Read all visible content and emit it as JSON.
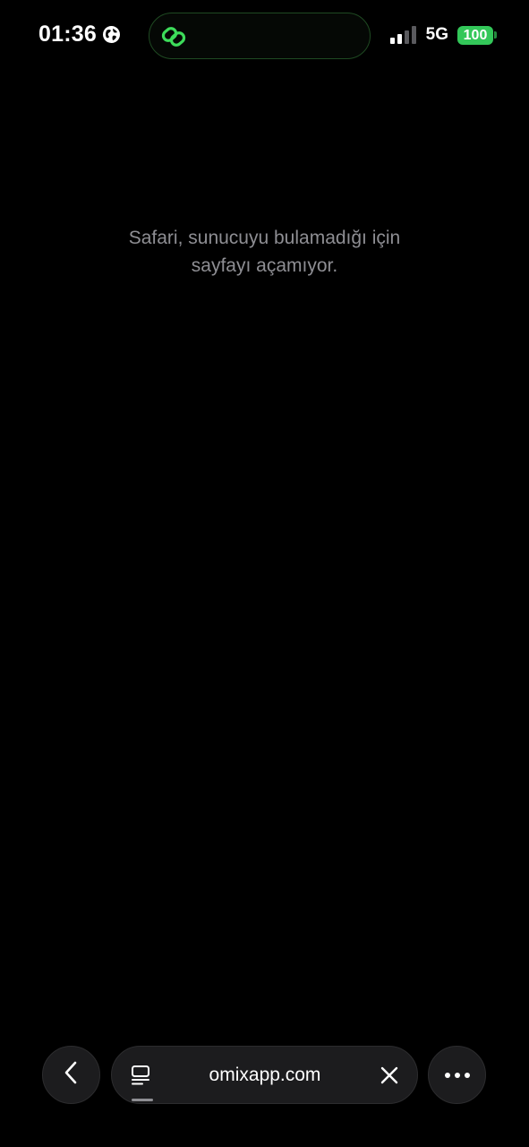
{
  "status_bar": {
    "time": "01:36",
    "time_icon": "globe-icon",
    "island_icon": "link-icon",
    "network": "5G",
    "signal_icon": "cellular-signal-icon",
    "battery_level": "100",
    "battery_color": "#33c759",
    "island_accent": "#3ddc5a"
  },
  "page": {
    "error_line_1": "Safari, sunucuyu bulamadığı için",
    "error_line_2": "sayfayı açamıyor."
  },
  "toolbar": {
    "back_icon": "chevron-left-icon",
    "tabs_icon": "tabs-icon",
    "url": "omixapp.com",
    "clear_icon": "close-icon",
    "more_icon": "ellipsis-icon"
  }
}
